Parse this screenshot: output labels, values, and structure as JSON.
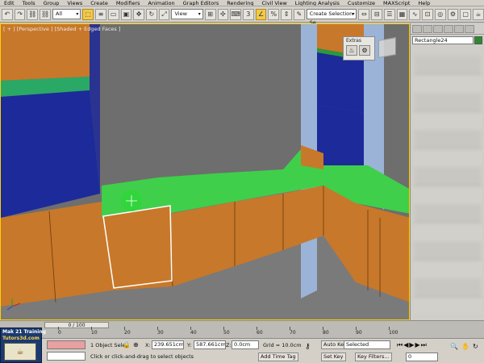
{
  "menu": [
    "Edit",
    "Tools",
    "Group",
    "Views",
    "Create",
    "Modifiers",
    "Animation",
    "Graph Editors",
    "Rendering",
    "Civil View",
    "Lighting Analysis",
    "Customize",
    "MAXScript",
    "Help"
  ],
  "toolbar": {
    "selection_filter": "All",
    "reference_coord": "View",
    "named_selection": "Create Selection Se"
  },
  "viewport": {
    "label": "[ + ] [Perspective ] [Shaded + Edged Faces ]",
    "extras_title": "Extras"
  },
  "command_panel": {
    "object_name": "Rectangle24",
    "object_color": "#2e8a2e"
  },
  "timeline": {
    "frame_display": "0 / 100",
    "ticks": [
      "0",
      "10",
      "20",
      "30",
      "40",
      "50",
      "60",
      "70",
      "80",
      "90",
      "100"
    ]
  },
  "logo": {
    "line1": "Mak 21 Training",
    "line2": "Tutors3d.com"
  },
  "status": {
    "selection_info": "1 Object Selec",
    "prompt": "Click or click-and-drag to select objects",
    "x_label": "X:",
    "x_value": "239.651cm",
    "y_label": "Y:",
    "y_value": "587.661cm",
    "z_label": "Z:",
    "z_value": "0.0cm",
    "grid": "Grid = 10.0cm",
    "add_time_tag": "Add Time Tag",
    "auto_key": "Auto Key",
    "set_key": "Set Key",
    "key_mode": "Selected",
    "key_filters": "Key Filters...",
    "frame": "0"
  },
  "colors": {
    "wood": "#c8782a",
    "blue_panel": "#1c2a9a",
    "green_top": "#3fcf4a",
    "selection_highlight": "#ffffff"
  }
}
